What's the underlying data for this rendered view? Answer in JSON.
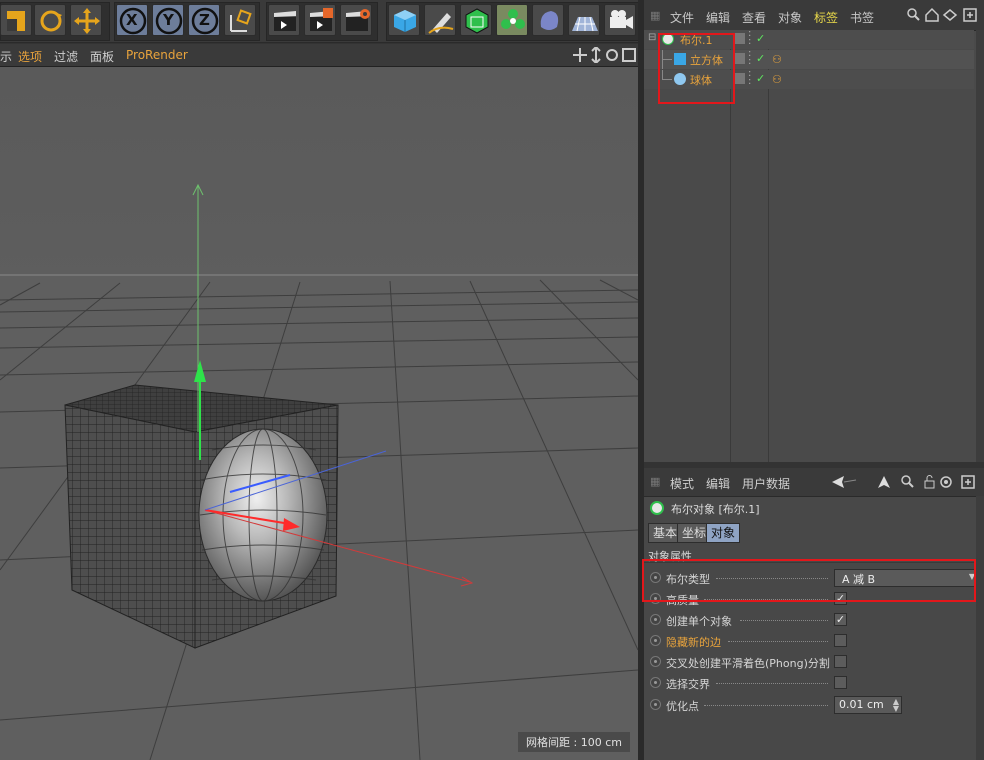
{
  "toolbar": {
    "x_label": "X",
    "y_label": "Y",
    "z_label": "Z"
  },
  "viewport_menu": {
    "items": [
      "示",
      "选项",
      "过滤",
      "面板",
      "ProRender"
    ],
    "grid_spacing": "网格间距 : 100 cm"
  },
  "object_manager": {
    "menu": [
      "文件",
      "编辑",
      "查看",
      "对象",
      "标签",
      "书签"
    ],
    "objects": [
      {
        "name": "布尔.1",
        "icon": "boole-icon",
        "level": 0
      },
      {
        "name": "立方体",
        "icon": "cube-icon",
        "level": 1
      },
      {
        "name": "球体",
        "icon": "sphere-icon",
        "level": 1
      }
    ]
  },
  "attribute_manager": {
    "menu": [
      "模式",
      "编辑",
      "用户数据"
    ],
    "title": "布尔对象 [布尔.1]",
    "tabs": [
      "基本",
      "坐标",
      "对象"
    ],
    "active_tab": "对象",
    "section": "对象属性",
    "properties": [
      {
        "label": "布尔类型",
        "type": "dropdown",
        "value": "A 减 B"
      },
      {
        "label": "高质量",
        "type": "checkbox",
        "checked": true
      },
      {
        "label": "创建单个对象",
        "type": "checkbox",
        "checked": true
      },
      {
        "label": "隐藏新的边",
        "type": "checkbox",
        "checked": false,
        "highlight": true
      },
      {
        "label": "交叉处创建平滑着色(Phong)分割",
        "type": "checkbox",
        "checked": false
      },
      {
        "label": "选择交界",
        "type": "checkbox",
        "checked": false
      },
      {
        "label": "优化点",
        "type": "number",
        "value": "0.01 cm"
      }
    ]
  },
  "colors": {
    "highlight_orange": "#e8a33c",
    "annotation_red": "#e3171b",
    "active_tab": "#8fa4c4"
  }
}
